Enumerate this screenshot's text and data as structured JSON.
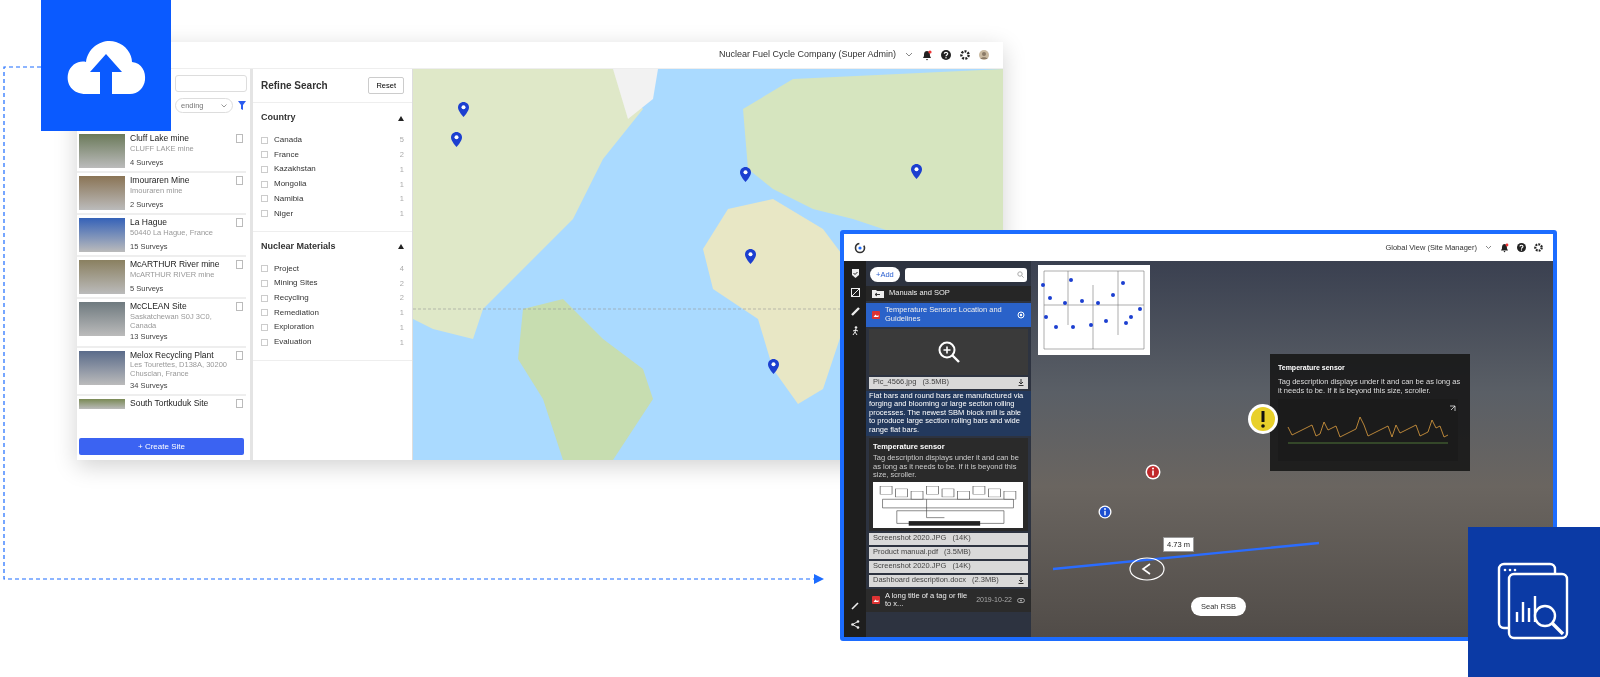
{
  "main_window": {
    "account": "Nuclear Fuel Cycle Company (Super Admin)",
    "sort": {
      "value": "ending"
    },
    "sites": [
      {
        "title": "Cluff Lake mine",
        "address": "CLUFF LAKE mine",
        "surveys": "4 Surveys"
      },
      {
        "title": "Imouraren Mine",
        "address": "Imouraren mine",
        "surveys": "2 Surveys"
      },
      {
        "title": "La Hague",
        "address": "50440 La Hague, France",
        "surveys": "15 Surveys"
      },
      {
        "title": "McARTHUR River mine",
        "address": "McARTHUR RIVER mine",
        "surveys": "5 Surveys"
      },
      {
        "title": "McCLEAN Site",
        "address": "Saskatchewan S0J 3C0, Canada",
        "surveys": "13 Surveys"
      },
      {
        "title": "Melox Recycling Plant",
        "address": "Les Tourettes, D138A, 30200 Chusclan, France",
        "surveys": "34 Surveys"
      },
      {
        "title": "South Tortkuduk Site"
      }
    ],
    "create_button": "+ Create Site",
    "refine": {
      "title": "Refine Search",
      "reset": "Reset",
      "groups": [
        {
          "title": "Country",
          "expanded": true,
          "options": [
            {
              "label": "Canada",
              "count": "5",
              "checked": false
            },
            {
              "label": "France",
              "count": "2",
              "checked": false
            },
            {
              "label": "Kazakhstan",
              "count": "1",
              "checked": false
            },
            {
              "label": "Mongolia",
              "count": "1",
              "checked": false
            },
            {
              "label": "Namibia",
              "count": "1",
              "checked": false
            },
            {
              "label": "Niger",
              "count": "1",
              "checked": false
            }
          ]
        },
        {
          "title": "Nuclear Materials",
          "expanded": true,
          "options": [
            {
              "label": "Project",
              "count": "4",
              "checked": false
            },
            {
              "label": "Mining Sites",
              "count": "2",
              "checked": false
            },
            {
              "label": "Recycling",
              "count": "2",
              "checked": false
            },
            {
              "label": "Remediation",
              "count": "1",
              "checked": false
            },
            {
              "label": "Exploration",
              "count": "1",
              "checked": false
            },
            {
              "label": "Evaluation",
              "count": "1",
              "checked": false
            }
          ]
        }
      ]
    }
  },
  "viewer_window": {
    "account": "Global View (Site Manager)",
    "add_button": "+Add",
    "folder": "Manuals and SOP",
    "selected_item": {
      "title": "Temperature Sensors Location and Guidelines",
      "selected": true
    },
    "image_file": {
      "name": "Pic_4566.jpg",
      "size": "(3.5MB)"
    },
    "description": "Flat bars and round bars are manufactured via forging and blooming or large section rolling processes. The newest SBM block mill is able to produce large section rolling bars and wide range flat bars.",
    "sensor_card": {
      "title": "Temperature sensor",
      "text": "Tag description displays under it and can be as long as it needs to be. If it is beyond this size, scroller."
    },
    "files": [
      {
        "name": "Screenshot 2020.JPG",
        "size": "(14K)"
      },
      {
        "name": "Product manual.pdf",
        "size": "(3.5MB)"
      },
      {
        "name": "Screenshot 2020.JPG",
        "size": "(14K)"
      },
      {
        "name": "Dashboard description.docx",
        "size": "(2.3MB)"
      }
    ],
    "last_item": {
      "title": "A long title of a tag or file to x...",
      "date": "2019-10-22",
      "selected": false
    },
    "tooltip": {
      "title": "Temperature sensor",
      "text": "Tag description displays under it and can be as long as it needs to be. If it is beyond this size, scroller."
    },
    "measurement": "4.73 m",
    "location_button": "Seah RSB"
  }
}
